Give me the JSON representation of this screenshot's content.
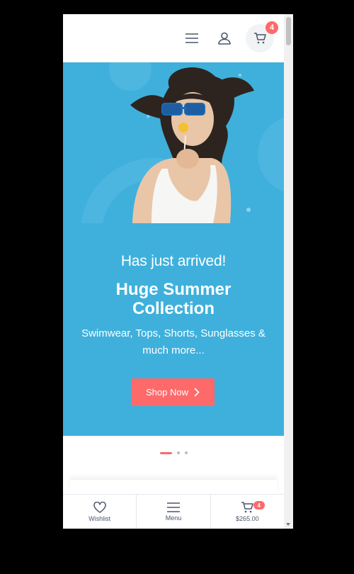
{
  "header": {
    "cart_count": "4"
  },
  "hero": {
    "kicker": "Has just arrived!",
    "title": "Huge Summer Collection",
    "subtitle": "Swimwear, Tops, Shorts, Sunglasses & much more...",
    "cta_label": "Shop Now",
    "background_color": "#3fb0dc",
    "accent_color": "#fe696a"
  },
  "carousel": {
    "slide_count": 3,
    "active_index": 0
  },
  "bottom_bar": {
    "wishlist_label": "Wishlist",
    "menu_label": "Menu",
    "cart_total": "$265.00",
    "cart_count": "4"
  },
  "icons": [
    "menu-icon",
    "user-icon",
    "cart-icon",
    "chevron-right-icon",
    "heart-icon"
  ]
}
